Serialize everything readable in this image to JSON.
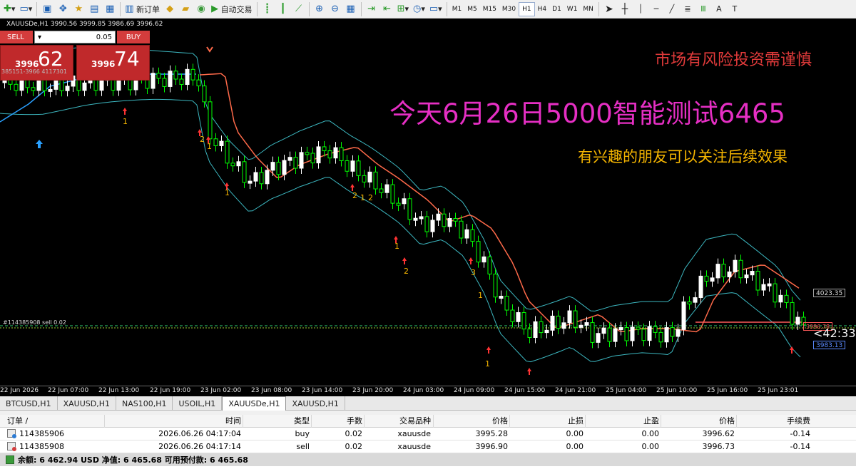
{
  "toolbar": {
    "new_order_label": "新订单",
    "autotrade_label": "自动交易",
    "timeframes": [
      "M1",
      "M5",
      "M15",
      "M30",
      "H1",
      "H4",
      "D1",
      "W1",
      "MN"
    ],
    "active_timeframe": "H1"
  },
  "chart": {
    "title": "XAUUSDe,H1  3990.56 3999.85 3986.69 3996.62",
    "overlay_risk": "市场有风险投资需谨慎",
    "overlay_headline": "今天6月26日5000智能测试6465",
    "overlay_follow": "有兴趣的朋友可以关注后续效果",
    "countdown": "<42:33",
    "price_labels": {
      "upper": "4023.35",
      "mid": "3996.78",
      "lower": "3983.13"
    },
    "position_line_label": "#114385908 sell 0.02",
    "indicator_label": "385151-3966 4117301",
    "signal_counts": [
      "1",
      "2",
      "1",
      "1",
      "2",
      "1",
      "2",
      "1",
      "2",
      "3",
      "1"
    ],
    "time_axis": [
      "22 Jun 2026",
      "22 Jun 07:00",
      "22 Jun 13:00",
      "22 Jun 19:00",
      "23 Jun 02:00",
      "23 Jun 08:00",
      "23 Jun 14:00",
      "23 Jun 20:00",
      "24 Jun 03:00",
      "24 Jun 09:00",
      "24 Jun 15:00",
      "24 Jun 21:00",
      "25 Jun 04:00",
      "25 Jun 10:00",
      "25 Jun 16:00",
      "25 Jun 23:01"
    ],
    "colors": {
      "bull_candle": "#ffffff",
      "bear_candle": "#00ff00",
      "upper_band": "#3cb7c0",
      "mid_line": "#ff6a4a",
      "signal_blue": "#2aa0ff"
    }
  },
  "one_click": {
    "sell_label": "SELL",
    "buy_label": "BUY",
    "lot": "0.05",
    "sell_price_small": "3996",
    "sell_price_big": "62",
    "buy_price_small": "3996",
    "buy_price_big": "74"
  },
  "tabs": [
    "BTCUSD,H1",
    "XAUUSD,H1",
    "NAS100,H1",
    "USOIL,H1",
    "XAUUSDe,H1",
    "XAUUSD,H1"
  ],
  "active_tab": "XAUUSDe,H1",
  "terminal": {
    "headers": {
      "order": "订单 /",
      "time": "时间",
      "type": "类型",
      "volume": "手数",
      "symbol": "交易品种",
      "price": "价格",
      "sl": "止损",
      "tp": "止盈",
      "current": "价格",
      "commission": "手续费"
    },
    "rows": [
      {
        "order": "114385906",
        "time": "2026.06.26 04:17:04",
        "type": "buy",
        "volume": "0.02",
        "symbol": "xauusde",
        "price": "3995.28",
        "sl": "0.00",
        "tp": "0.00",
        "current": "3996.62",
        "commission": "-0.14"
      },
      {
        "order": "114385908",
        "time": "2026.06.26 04:17:14",
        "type": "sell",
        "volume": "0.02",
        "symbol": "xauusde",
        "price": "3996.90",
        "sl": "0.00",
        "tp": "0.00",
        "current": "3996.73",
        "commission": "-0.14"
      }
    ],
    "balance_line": "余额: 6 462.94 USD  净值: 6 465.68  可用预付款: 6 465.68"
  }
}
